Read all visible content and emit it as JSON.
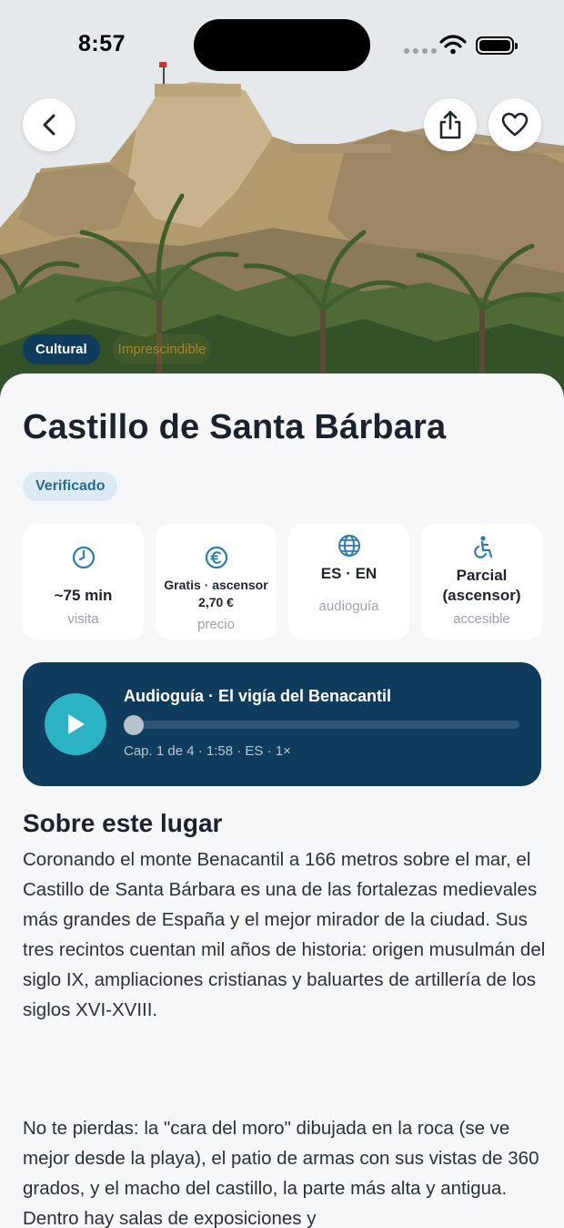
{
  "status_bar": {
    "time": "8:57"
  },
  "hero": {
    "tags": [
      {
        "label": "Cultural"
      },
      {
        "label": "Imprescindible"
      }
    ]
  },
  "place": {
    "title": "Castillo de Santa Bárbara",
    "badge": "Verificado"
  },
  "info_cards": [
    {
      "icon": "clock-icon",
      "value": "~75 min",
      "label": "visita"
    },
    {
      "icon": "euro-icon",
      "value": "Gratis · ascensor 2,70 €",
      "label": "precio"
    },
    {
      "icon": "globe-icon",
      "value": "ES · EN",
      "label": "audioguía"
    },
    {
      "icon": "accessibility-icon",
      "value": "Parcial (ascensor)",
      "label": "accesible"
    }
  ],
  "audio_player": {
    "title": "Audioguía · El vigía del Benacantil",
    "meta": "Cap. 1 de 4 · 1:58 · ES · 1×",
    "progress": 0
  },
  "about": {
    "heading": "Sobre este lugar",
    "paragraphs": [
      "Coronando el monte Benacantil a 166 metros sobre el mar, el Castillo de Santa Bárbara es una de las fortalezas medievales más grandes de España y el mejor mirador de la ciudad. Sus tres recintos cuentan mil años de historia: origen musulmán del siglo IX, ampliaciones cristianas y baluartes de artillería de los siglos XVI-XVIII.",
      "No te pierdas: la \"cara del moro\" dibujada en la roca (se ve mejor desde la playa), el patio de armas con sus vistas de 360 grados, y el macho del castillo, la parte más alta y antigua. Dentro hay salas de exposiciones y"
    ]
  },
  "colors": {
    "primary_dark": "#0f3c5c",
    "accent_teal": "#2bb3c4",
    "icon_blue": "#2a7bb0",
    "background": "#f5f7f9"
  }
}
